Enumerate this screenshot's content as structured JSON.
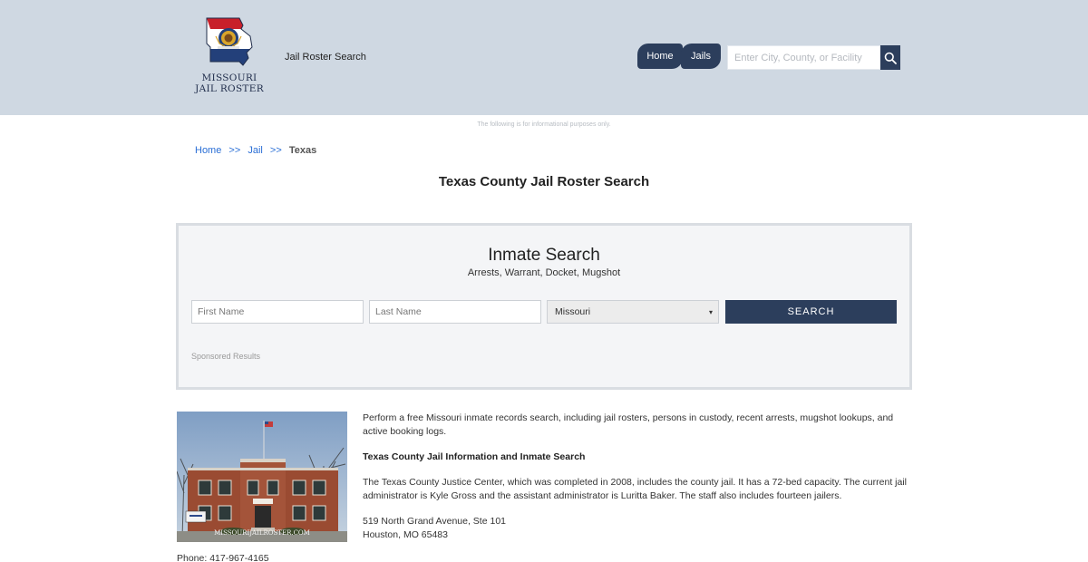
{
  "header": {
    "logo_text_line1": "MISSOURI",
    "logo_text_line2": "JAIL ROSTER",
    "site_title": "Jail Roster Search",
    "nav": [
      {
        "label": "Home"
      },
      {
        "label": "Jails"
      }
    ],
    "search_placeholder": "Enter City, County, or Facility",
    "search_icon": "magnifier-icon"
  },
  "disclaimer": "The following is for informational purposes only.",
  "breadcrumb": {
    "items": [
      "Home",
      "Jail"
    ],
    "separator": ">>",
    "current": "Texas"
  },
  "page_title": "Texas County Jail Roster Search",
  "inmate_search": {
    "title": "Inmate Search",
    "subtitle": "Arrests, Warrant, Docket, Mugshot",
    "first_name_placeholder": "First Name",
    "last_name_placeholder": "Last Name",
    "state_selected": "Missouri",
    "search_button": "SEARCH",
    "sponsored": "Sponsored Results"
  },
  "photo": {
    "watermark": "MISSOURIJAILROSTER.COM"
  },
  "content": {
    "intro": "Perform a free Missouri inmate records search, including jail rosters, persons in custody, recent arrests, mugshot lookups, and active booking logs.",
    "section_heading": "Texas County Jail Information and Inmate Search",
    "description": "The Texas County Justice Center, which was completed in 2008, includes the county jail. It has a 72-bed capacity. The current jail administrator is Kyle Gross and the assistant administrator is Luritta Baker. The staff also includes fourteen jailers.",
    "address_line1": "519 North Grand Avenue, Ste 101",
    "address_line2": "Houston, MO 65483",
    "phone": "Phone: 417-967-4165"
  },
  "colors": {
    "header_bg": "#cfd8e2",
    "navy": "#2c3e5c",
    "link": "#2b6fd6",
    "panel_bg": "#f4f5f7"
  }
}
